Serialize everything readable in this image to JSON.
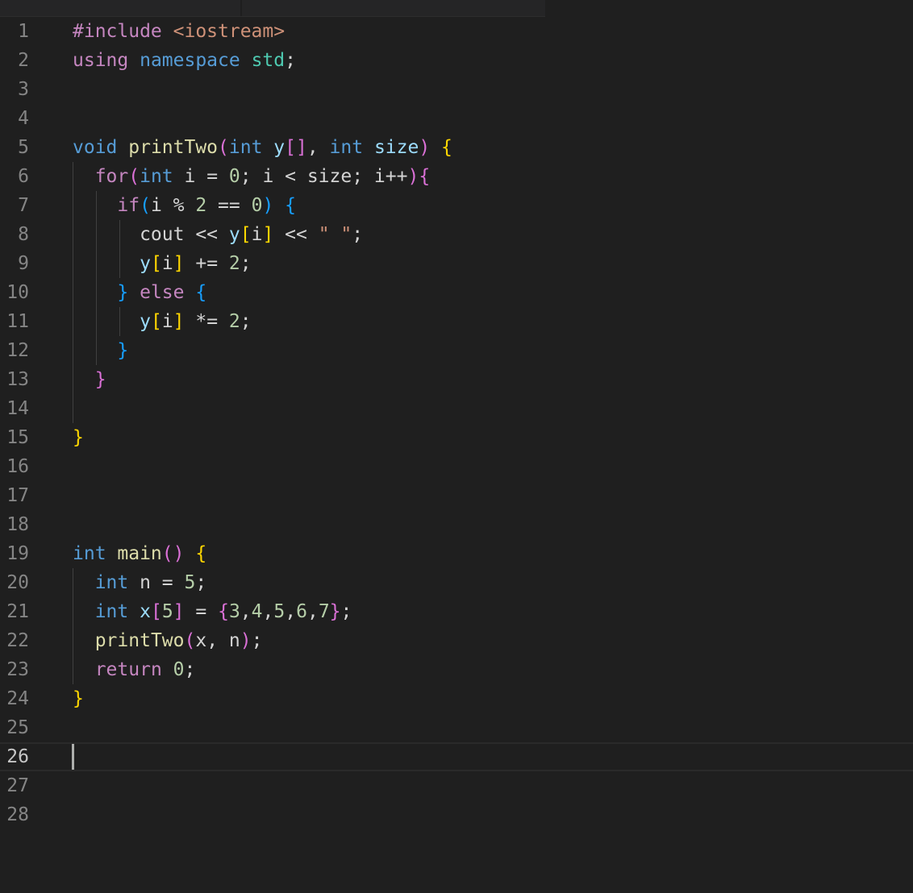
{
  "editor": {
    "language": "C++",
    "active_line": 26,
    "colors": {
      "background": "#1f1f1f",
      "keyword_purple": "#c586c0",
      "keyword_blue": "#569cd6",
      "function": "#dcdcaa",
      "type": "#4ec9b0",
      "variable": "#9cdcfe",
      "string": "#ce9178",
      "number": "#b5cea8",
      "bracket_gold": "#ffd700",
      "bracket_pink": "#da70d6",
      "bracket_blue": "#179fff"
    },
    "lines": [
      {
        "num": "1",
        "tokens": [
          {
            "t": "#include ",
            "c": "#c586c0"
          },
          {
            "t": "<iostream>",
            "c": "#ce9178"
          }
        ]
      },
      {
        "num": "2",
        "tokens": [
          {
            "t": "using ",
            "c": "#c586c0"
          },
          {
            "t": "namespace ",
            "c": "#569cd6"
          },
          {
            "t": "std",
            "c": "#4ec9b0"
          },
          {
            "t": ";",
            "c": "#d4d4d4"
          }
        ]
      },
      {
        "num": "3",
        "tokens": []
      },
      {
        "num": "4",
        "tokens": []
      },
      {
        "num": "5",
        "tokens": [
          {
            "t": "void ",
            "c": "#569cd6"
          },
          {
            "t": "printTwo",
            "c": "#dcdcaa"
          },
          {
            "t": "(",
            "c": "#da70d6"
          },
          {
            "t": "int ",
            "c": "#569cd6"
          },
          {
            "t": "y",
            "c": "#9cdcfe"
          },
          {
            "t": "[]",
            "c": "#da70d6"
          },
          {
            "t": ", ",
            "c": "#d4d4d4"
          },
          {
            "t": "int ",
            "c": "#569cd6"
          },
          {
            "t": "size",
            "c": "#9cdcfe"
          },
          {
            "t": ")",
            "c": "#da70d6"
          },
          {
            "t": " ",
            "c": "#d4d4d4"
          },
          {
            "t": "{",
            "c": "#ffd700"
          }
        ]
      },
      {
        "num": "6",
        "tokens": [
          {
            "t": "  ",
            "c": "#d4d4d4"
          },
          {
            "t": "for",
            "c": "#c586c0"
          },
          {
            "t": "(",
            "c": "#da70d6"
          },
          {
            "t": "int ",
            "c": "#569cd6"
          },
          {
            "t": "i = ",
            "c": "#d4d4d4"
          },
          {
            "t": "0",
            "c": "#b5cea8"
          },
          {
            "t": "; i < size; i++",
            "c": "#d4d4d4"
          },
          {
            "t": ")",
            "c": "#da70d6"
          },
          {
            "t": "{",
            "c": "#da70d6"
          }
        ]
      },
      {
        "num": "7",
        "tokens": [
          {
            "t": "    ",
            "c": "#d4d4d4"
          },
          {
            "t": "if",
            "c": "#c586c0"
          },
          {
            "t": "(",
            "c": "#179fff"
          },
          {
            "t": "i % ",
            "c": "#d4d4d4"
          },
          {
            "t": "2",
            "c": "#b5cea8"
          },
          {
            "t": " == ",
            "c": "#d4d4d4"
          },
          {
            "t": "0",
            "c": "#b5cea8"
          },
          {
            "t": ")",
            "c": "#179fff"
          },
          {
            "t": " ",
            "c": "#d4d4d4"
          },
          {
            "t": "{",
            "c": "#179fff"
          }
        ]
      },
      {
        "num": "8",
        "tokens": [
          {
            "t": "      cout << ",
            "c": "#d4d4d4"
          },
          {
            "t": "y",
            "c": "#9cdcfe"
          },
          {
            "t": "[",
            "c": "#ffd700"
          },
          {
            "t": "i",
            "c": "#d4d4d4"
          },
          {
            "t": "]",
            "c": "#ffd700"
          },
          {
            "t": " << ",
            "c": "#d4d4d4"
          },
          {
            "t": "\" \"",
            "c": "#ce9178"
          },
          {
            "t": ";",
            "c": "#d4d4d4"
          }
        ]
      },
      {
        "num": "9",
        "tokens": [
          {
            "t": "      ",
            "c": "#d4d4d4"
          },
          {
            "t": "y",
            "c": "#9cdcfe"
          },
          {
            "t": "[",
            "c": "#ffd700"
          },
          {
            "t": "i",
            "c": "#d4d4d4"
          },
          {
            "t": "]",
            "c": "#ffd700"
          },
          {
            "t": " += ",
            "c": "#d4d4d4"
          },
          {
            "t": "2",
            "c": "#b5cea8"
          },
          {
            "t": ";",
            "c": "#d4d4d4"
          }
        ]
      },
      {
        "num": "10",
        "tokens": [
          {
            "t": "    ",
            "c": "#d4d4d4"
          },
          {
            "t": "}",
            "c": "#179fff"
          },
          {
            "t": " ",
            "c": "#d4d4d4"
          },
          {
            "t": "else",
            "c": "#c586c0"
          },
          {
            "t": " ",
            "c": "#d4d4d4"
          },
          {
            "t": "{",
            "c": "#179fff"
          }
        ]
      },
      {
        "num": "11",
        "tokens": [
          {
            "t": "      ",
            "c": "#d4d4d4"
          },
          {
            "t": "y",
            "c": "#9cdcfe"
          },
          {
            "t": "[",
            "c": "#ffd700"
          },
          {
            "t": "i",
            "c": "#d4d4d4"
          },
          {
            "t": "]",
            "c": "#ffd700"
          },
          {
            "t": " *= ",
            "c": "#d4d4d4"
          },
          {
            "t": "2",
            "c": "#b5cea8"
          },
          {
            "t": ";",
            "c": "#d4d4d4"
          }
        ]
      },
      {
        "num": "12",
        "tokens": [
          {
            "t": "    ",
            "c": "#d4d4d4"
          },
          {
            "t": "}",
            "c": "#179fff"
          }
        ]
      },
      {
        "num": "13",
        "tokens": [
          {
            "t": "  ",
            "c": "#d4d4d4"
          },
          {
            "t": "}",
            "c": "#da70d6"
          }
        ]
      },
      {
        "num": "14",
        "tokens": []
      },
      {
        "num": "15",
        "tokens": [
          {
            "t": "}",
            "c": "#ffd700"
          }
        ]
      },
      {
        "num": "16",
        "tokens": []
      },
      {
        "num": "17",
        "tokens": []
      },
      {
        "num": "18",
        "tokens": []
      },
      {
        "num": "19",
        "tokens": [
          {
            "t": "int ",
            "c": "#569cd6"
          },
          {
            "t": "main",
            "c": "#dcdcaa"
          },
          {
            "t": "()",
            "c": "#da70d6"
          },
          {
            "t": " ",
            "c": "#d4d4d4"
          },
          {
            "t": "{",
            "c": "#ffd700"
          }
        ]
      },
      {
        "num": "20",
        "tokens": [
          {
            "t": "  ",
            "c": "#d4d4d4"
          },
          {
            "t": "int ",
            "c": "#569cd6"
          },
          {
            "t": "n = ",
            "c": "#d4d4d4"
          },
          {
            "t": "5",
            "c": "#b5cea8"
          },
          {
            "t": ";",
            "c": "#d4d4d4"
          }
        ]
      },
      {
        "num": "21",
        "tokens": [
          {
            "t": "  ",
            "c": "#d4d4d4"
          },
          {
            "t": "int ",
            "c": "#569cd6"
          },
          {
            "t": "x",
            "c": "#9cdcfe"
          },
          {
            "t": "[",
            "c": "#da70d6"
          },
          {
            "t": "5",
            "c": "#b5cea8"
          },
          {
            "t": "]",
            "c": "#da70d6"
          },
          {
            "t": " = ",
            "c": "#d4d4d4"
          },
          {
            "t": "{",
            "c": "#da70d6"
          },
          {
            "t": "3",
            "c": "#b5cea8"
          },
          {
            "t": ",",
            "c": "#d4d4d4"
          },
          {
            "t": "4",
            "c": "#b5cea8"
          },
          {
            "t": ",",
            "c": "#d4d4d4"
          },
          {
            "t": "5",
            "c": "#b5cea8"
          },
          {
            "t": ",",
            "c": "#d4d4d4"
          },
          {
            "t": "6",
            "c": "#b5cea8"
          },
          {
            "t": ",",
            "c": "#d4d4d4"
          },
          {
            "t": "7",
            "c": "#b5cea8"
          },
          {
            "t": "}",
            "c": "#da70d6"
          },
          {
            "t": ";",
            "c": "#d4d4d4"
          }
        ]
      },
      {
        "num": "22",
        "tokens": [
          {
            "t": "  ",
            "c": "#d4d4d4"
          },
          {
            "t": "printTwo",
            "c": "#dcdcaa"
          },
          {
            "t": "(",
            "c": "#da70d6"
          },
          {
            "t": "x, n",
            "c": "#d4d4d4"
          },
          {
            "t": ")",
            "c": "#da70d6"
          },
          {
            "t": ";",
            "c": "#d4d4d4"
          }
        ]
      },
      {
        "num": "23",
        "tokens": [
          {
            "t": "  ",
            "c": "#d4d4d4"
          },
          {
            "t": "return ",
            "c": "#c586c0"
          },
          {
            "t": "0",
            "c": "#b5cea8"
          },
          {
            "t": ";",
            "c": "#d4d4d4"
          }
        ]
      },
      {
        "num": "24",
        "tokens": [
          {
            "t": "}",
            "c": "#ffd700"
          }
        ]
      },
      {
        "num": "25",
        "tokens": []
      },
      {
        "num": "26",
        "tokens": []
      },
      {
        "num": "27",
        "tokens": []
      },
      {
        "num": "28",
        "tokens": []
      }
    ]
  }
}
